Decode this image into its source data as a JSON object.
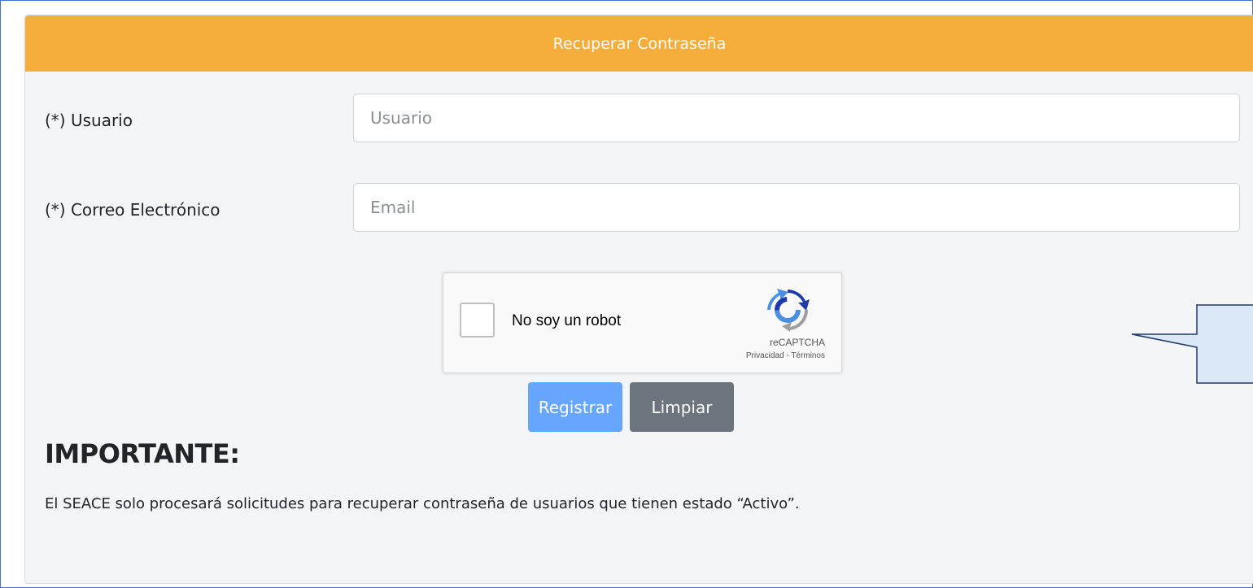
{
  "header": {
    "title": "Recuperar Contraseña"
  },
  "form": {
    "usuario": {
      "label": "(*) Usuario",
      "placeholder": "Usuario",
      "value": ""
    },
    "email": {
      "label": "(*) Correo Electrónico",
      "placeholder": "Email",
      "value": ""
    }
  },
  "captcha": {
    "label": "No soy un robot",
    "brand": "reCAPTCHA",
    "privacy": "Privacidad",
    "separator": " - ",
    "terms": "Términos",
    "checked": false,
    "logo_icon": "recaptcha-logo-icon"
  },
  "buttons": {
    "register": "Registrar",
    "clear": "Limpiar"
  },
  "important": {
    "title": "IMPORTANTE:",
    "text": "El SEACE solo procesará solicitudes para recuperar contraseña de usuarios que tienen estado “Activo”."
  },
  "colors": {
    "header_bg": "#f5ad3b",
    "primary_button": "#66a6ff",
    "secondary_button": "#6c757d",
    "frame_border": "#4472c4",
    "callout_fill": "#dbe9f7"
  }
}
